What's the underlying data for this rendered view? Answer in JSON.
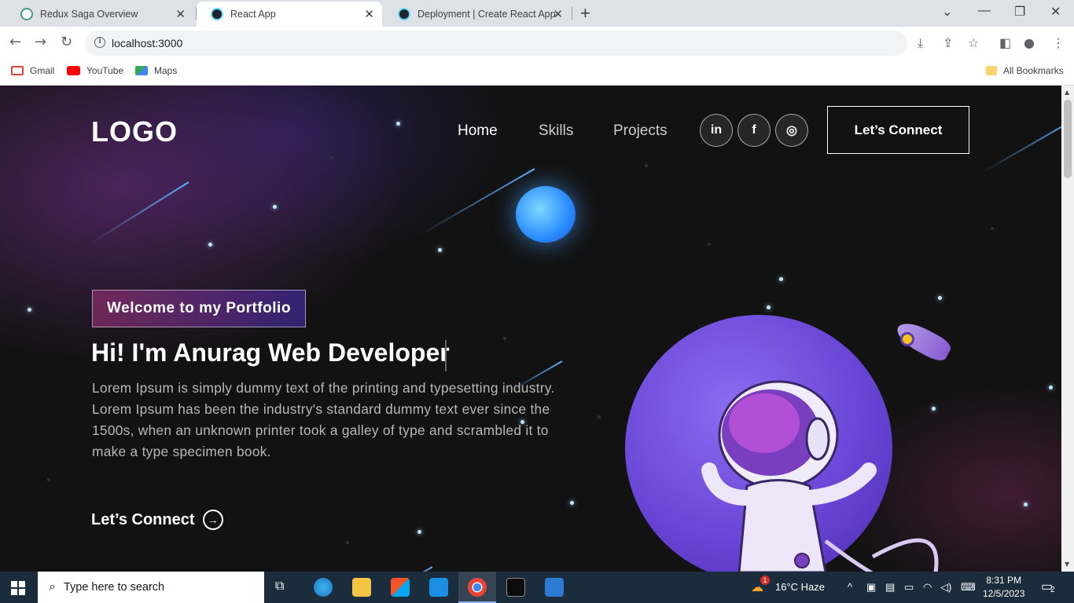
{
  "browser": {
    "tabs": [
      {
        "title": "Redux Saga Overview",
        "active": false
      },
      {
        "title": "React App",
        "active": true
      },
      {
        "title": "Deployment | Create React App",
        "active": false
      }
    ],
    "url": "localhost:3000",
    "bookmarks": [
      "Gmail",
      "YouTube",
      "Maps"
    ],
    "all_bookmarks": "All Bookmarks"
  },
  "page": {
    "logo": "LOGO",
    "nav": [
      "Home",
      "Skills",
      "Projects"
    ],
    "social": [
      "in",
      "f",
      "◎"
    ],
    "connect_button": "Let’s Connect",
    "tagline": "Welcome to my Portfolio",
    "headline": "Hi! I'm Anurag Web Developer",
    "intro": "Lorem Ipsum is simply dummy text of the printing and typesetting industry. Lorem Ipsum has been the industry's standard dummy text ever since the 1500s, when an unknown printer took a galley of type and scrambled it to make a type specimen book.",
    "cta": "Let’s Connect"
  },
  "taskbar": {
    "search_placeholder": "Type here to search",
    "weather": "16°C  Haze",
    "weather_badge": "1",
    "time": "8:31 PM",
    "date": "12/5/2023",
    "notifications": "2"
  },
  "colors": {
    "tab_bar": "#dee1e6",
    "page_bg": "#121212",
    "taskbar": "#1b2c3d",
    "tagline_gradient_start": "#aa367c",
    "tagline_gradient_end": "#4a2fbd"
  }
}
